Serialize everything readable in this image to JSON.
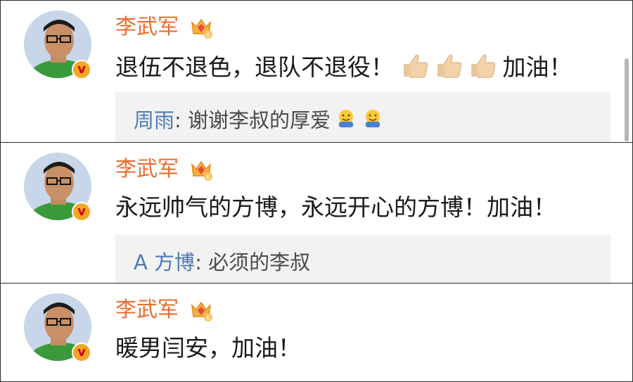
{
  "comments": [
    {
      "username": "李武军",
      "text": "退伍不退色，退队不退役！",
      "text_suffix": "加油！",
      "emoji": [
        "thumbs-up-icon",
        "thumbs-up-icon",
        "thumbs-up-icon"
      ],
      "reply": {
        "name": "周雨",
        "sep": ": ",
        "text": "谢谢李叔的厚爱",
        "emoji": [
          "hug-face-icon",
          "hug-face-icon"
        ]
      }
    },
    {
      "username": "李武军",
      "text": "永远帅气的方博，永远开心的方博！加油！",
      "reply": {
        "name": "A 方博",
        "sep": ": ",
        "text": "必须的李叔"
      }
    },
    {
      "username": "李武军",
      "text": "暖男闫安，加油！"
    }
  ],
  "verified_badge": "v",
  "level_badge": "6",
  "colors": {
    "username": "#e86c2c",
    "reply_name": "#4e7bb4",
    "reply_bg": "#f2f2f2"
  }
}
